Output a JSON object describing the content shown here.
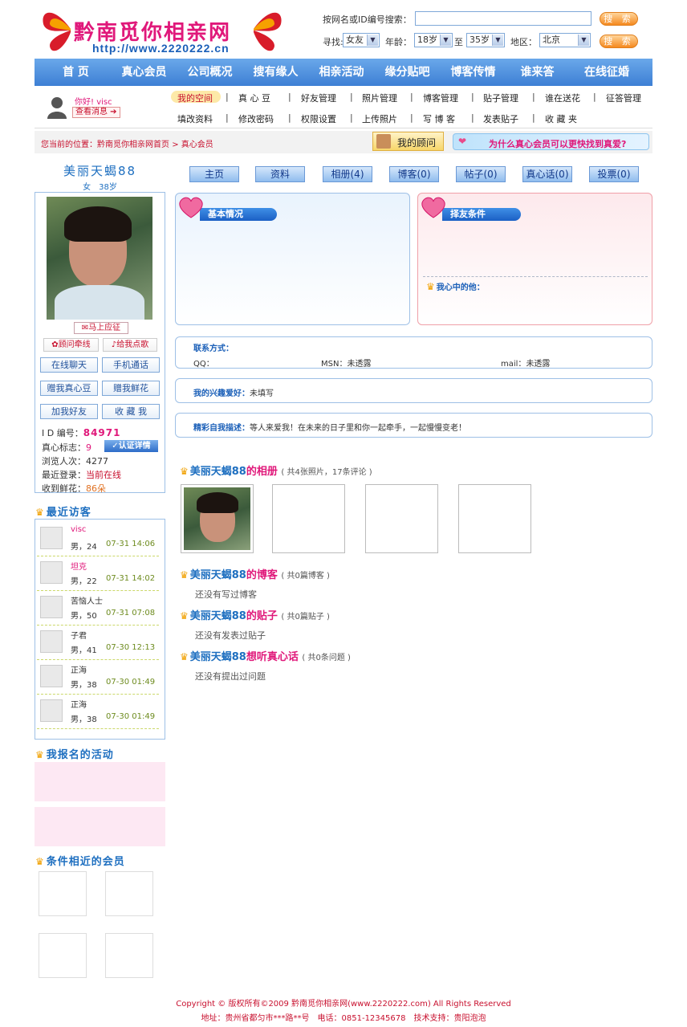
{
  "site": {
    "logo_text": "黔南觅你相亲网",
    "url": "http://www.2220222.cn"
  },
  "search": {
    "id_label": "按网名或ID编号搜索：",
    "search_btn": "搜 索",
    "find_label": "寻找:",
    "find_value": "女友",
    "age_label": "年龄：",
    "age_from": "18岁",
    "to_label": "至",
    "age_to": "35岁",
    "region_label": "地区：",
    "region_value": "北京",
    "search_btn2": "搜 索"
  },
  "nav": [
    "首 页",
    "真心会员",
    "公司概况",
    "搜有缘人",
    "相亲活动",
    "缘分贴吧",
    "博客传情",
    "谁来答",
    "在线征婚"
  ],
  "user": {
    "greeting": "你好!",
    "name": "visc",
    "msg_btn": "查看消息"
  },
  "submenu_row1": [
    "我的空间",
    "真 心 豆",
    "好友管理",
    "照片管理",
    "博客管理",
    "贴子管理",
    "谁在送花",
    "征答管理"
  ],
  "submenu_row2": [
    "填改资料",
    "修改密码",
    "权限设置",
    "上传照片",
    "写 博 客",
    "发表贴子",
    "收 藏 夹"
  ],
  "breadcrumb": {
    "prefix": "您当前的位置：",
    "site": "黔南觅你相亲网首页",
    "sep": ">",
    "current": "真心会员"
  },
  "advisor_btn": "我的顾问",
  "banner_text": "为什么真心会员可以更快找到真爱?",
  "profile": {
    "name": "美丽天蝎88",
    "gender_age": "女　38岁",
    "apply_btn": "马上应征",
    "advisor_link": "顾问牵线",
    "song_btn": "给我点歌",
    "chat_btn": "在线聊天",
    "phone_btn": "手机通话",
    "bean_btn": "赠我真心豆",
    "flower_btn": "赠我鲜花",
    "friend_btn": "加我好友",
    "fav_btn": "收 藏 我",
    "id_label": "I D 编号：",
    "id_value": "84971",
    "heart_label": "真心标志：",
    "heart_value": "9",
    "cert_btn": "认证详情",
    "views_label": "浏览人次：",
    "views_value": "4277",
    "login_label": "最近登录：",
    "login_value": "当前在线",
    "flowers_label": "收到鲜花：",
    "flowers_value": "86朵"
  },
  "visitors": {
    "title": "最近访客",
    "items": [
      {
        "name": "visc",
        "info": "男，24",
        "time": "07-31 14:06"
      },
      {
        "name": "坦克",
        "info": "男，22",
        "time": "07-31 14:02"
      },
      {
        "name": "苦恼人士",
        "info": "男，50",
        "time": "07-31 07:08"
      },
      {
        "name": "子君",
        "info": "男，41",
        "time": "07-30 12:13"
      },
      {
        "name": "正海",
        "info": "男，38",
        "time": "07-30 01:49"
      },
      {
        "name": "正海",
        "info": "男，38",
        "time": "07-30 01:49"
      }
    ]
  },
  "activities_title": "我报名的活动",
  "similar_title": "条件相近的会员",
  "tabs": [
    "主页",
    "资料",
    "相册(4)",
    "博客(0)",
    "帖子(0)",
    "真心话(0)",
    "投票(0)"
  ],
  "basic_title": "基本情况",
  "criteria_title": "择友条件",
  "ideal_label": "我心中的他：",
  "contact": {
    "title": "联系方式：",
    "qq_label": "QQ：",
    "msn_label": "MSN：",
    "msn_value": "未透露",
    "mail_label": "mail：",
    "mail_value": "未透露"
  },
  "hobby": {
    "label": "我的兴趣爱好：",
    "value": "未填写"
  },
  "intro": {
    "label": "精彩自我描述：",
    "value": "等人来爱我！在未来的日子里和你一起牵手，一起慢慢变老！"
  },
  "album": {
    "owner": "美丽天蝎88",
    "title": "的相册",
    "sub": "( 共4张照片，17条评论 )"
  },
  "blog": {
    "owner": "美丽天蝎88",
    "title": "的博客",
    "sub": "( 共0篇博客 )",
    "empty": "还没有写过博客"
  },
  "posts": {
    "owner": "美丽天蝎88",
    "title": "的贴子",
    "sub": "( 共0篇贴子 )",
    "empty": "还没有发表过贴子"
  },
  "truth": {
    "owner": "美丽天蝎88",
    "title": "想听真心话",
    "sub": "( 共0条问题 )",
    "empty": "还没有提出过问题"
  },
  "footer": {
    "line1": "Copyright © 版权所有©2009 黔南觅你相亲网(www.2220222.com) All Rights Reserved",
    "line2": "地址：贵州省都匀市***路**号　电话：0851-12345678　技术支持：贵阳泡泡"
  },
  "colors": {
    "nav": "#3d7fd4",
    "pink": "#e0187a",
    "blue": "#1e6fc0"
  }
}
